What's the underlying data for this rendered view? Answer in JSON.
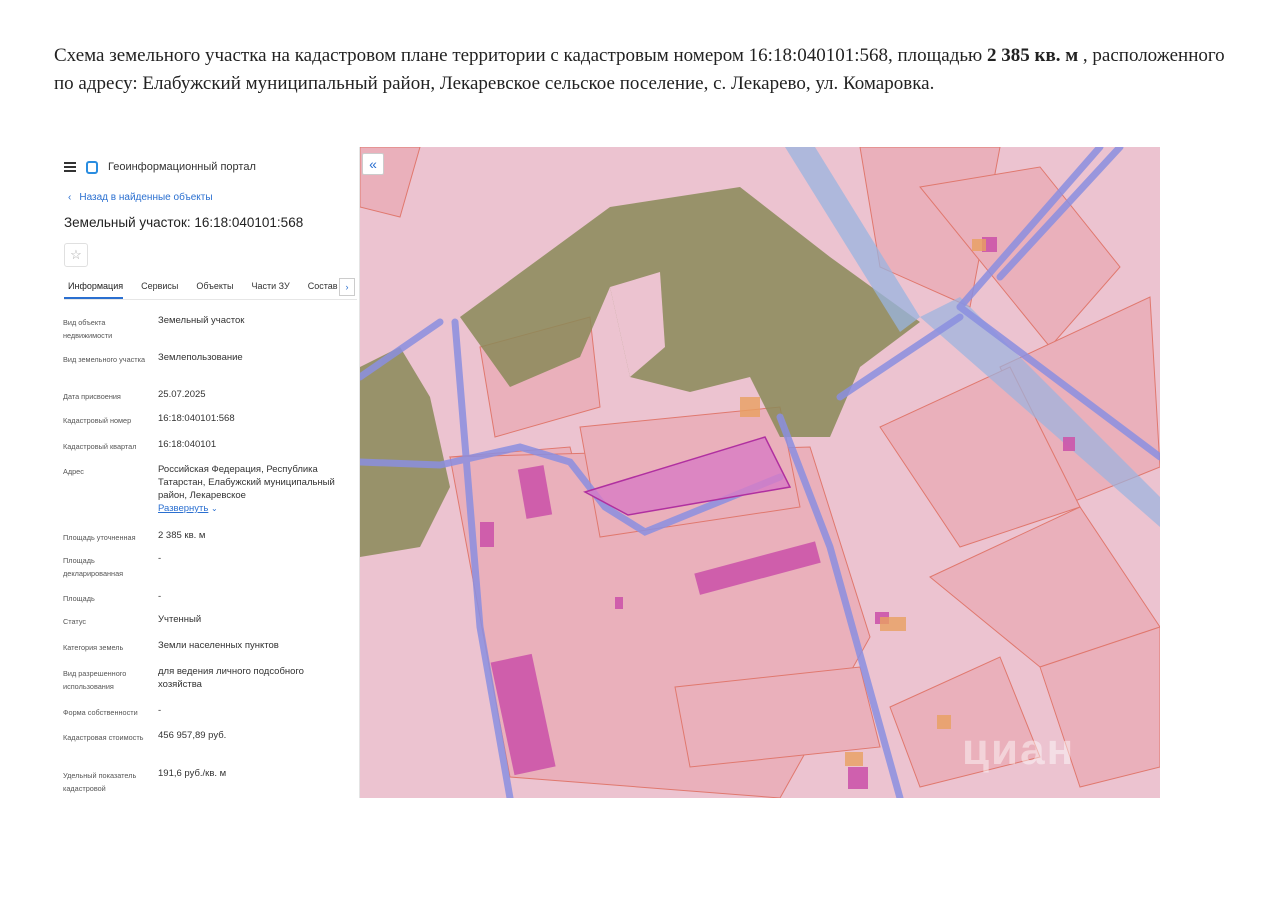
{
  "caption": {
    "text_1": "Схема земельного участка на кадастровом плане территории с кадастровым номером 16:18:040101:568, площадью ",
    "area_bold": "2 385 кв. м",
    "text_2": " , расположенного по адресу: Елабужский муниципальный район, Лекаревское сельское поселение, с. Лекарево, ул. Комаровка."
  },
  "header": {
    "app_title": "Геоинформационный портал",
    "menu_icon": "menu-icon",
    "logo_icon": "portal-logo-icon"
  },
  "back_link": {
    "label": "Назад в найденные объекты",
    "icon": "chevron-left-icon"
  },
  "object": {
    "title": "Земельный участок: 16:18:040101:568",
    "star_icon": "☆"
  },
  "tabs": [
    {
      "label": "Информация",
      "active": true
    },
    {
      "label": "Сервисы"
    },
    {
      "label": "Объекты"
    },
    {
      "label": "Части ЗУ"
    },
    {
      "label": "Состав"
    }
  ],
  "tab_arrow": "›",
  "fields": [
    {
      "label": "Вид объекта недвижимости",
      "value": "Земельный участок"
    },
    {
      "label": "Вид земельного участка",
      "value": "Землепользование"
    },
    {
      "label": "Дата присвоения",
      "value": "25.07.2025"
    },
    {
      "label": "Кадастровый номер",
      "value": "16:18:040101:568"
    },
    {
      "label": "Кадастровый квартал",
      "value": "16:18:040101"
    },
    {
      "label": "Адрес",
      "value": "Российская Федерация, Республика Татарстан, Елабужский муниципальный район, Лекаревское",
      "link": "Развернуть"
    },
    {
      "label": "Площадь уточненная",
      "value": "2 385 кв. м"
    },
    {
      "label": "Площадь декларированная",
      "value": "-"
    },
    {
      "label": "Площадь",
      "value": "-"
    },
    {
      "label": "Статус",
      "value": "Учтенный"
    },
    {
      "label": "Категория земель",
      "value": "Земли населенных пунктов"
    },
    {
      "label": "Вид разрешенного использования",
      "value": "для ведения личного подсобного хозяйства"
    },
    {
      "label": "Форма собственности",
      "value": "-"
    },
    {
      "label": "Кадастровая стоимость",
      "value": "456 957,89 руб."
    },
    {
      "label": "Удельный показатель кадастровой",
      "value": "191,6 руб./кв. м"
    }
  ],
  "map": {
    "collapse_label": "«",
    "watermark": "циан",
    "colors": {
      "background": "#ecc3d0",
      "parcel_fill": "#eab0bb",
      "forest": "#8a8a58",
      "water": "#9ab4e0",
      "road": "#8b8fe0",
      "building": "#cc55aa",
      "selected": "#d87cc4"
    }
  }
}
